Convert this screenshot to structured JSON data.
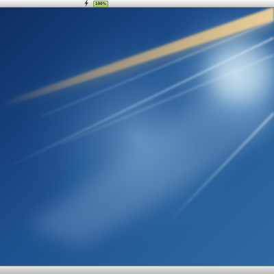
{
  "top_panel": {
    "power_icon": "lightning-bolt-icon",
    "battery_text": "100%",
    "battery_level": 1.0
  },
  "desktop": {
    "wallpaper": "blue-light-rays"
  },
  "colors": {
    "wallpaper_dark": "#0c2d63",
    "wallpaper_mid": "#2a6aa8",
    "wallpaper_light": "#a9cde6",
    "ray_gold": "#d9b27a",
    "battery_green": "#96c35a"
  }
}
